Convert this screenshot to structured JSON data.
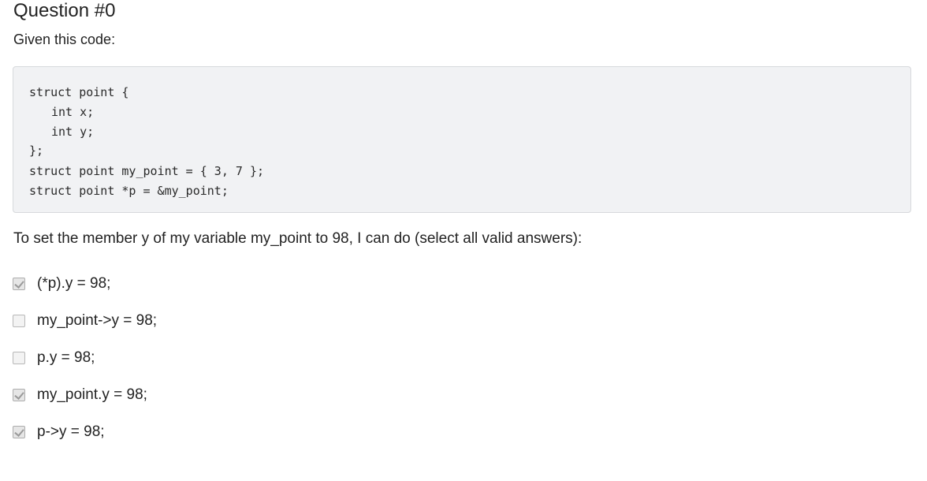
{
  "question": {
    "title": "Question #0",
    "intro": "Given this code:",
    "code_lines": [
      "struct point {",
      "int x;",
      "int y;",
      "};",
      "struct point my_point = { 3, 7 };",
      "struct point *p = &my_point;"
    ],
    "prompt": "To set the member y of my variable my_point to 98, I can do (select all valid answers):"
  },
  "answers": [
    {
      "label": "(*p).y = 98;",
      "checked": true
    },
    {
      "label": "my_point->y = 98;",
      "checked": false
    },
    {
      "label": "p.y = 98;",
      "checked": false
    },
    {
      "label": "my_point.y = 98;",
      "checked": true
    },
    {
      "label": "p->y = 98;",
      "checked": true
    }
  ],
  "icons": {
    "checkbox_checked": "checkmark-icon"
  }
}
